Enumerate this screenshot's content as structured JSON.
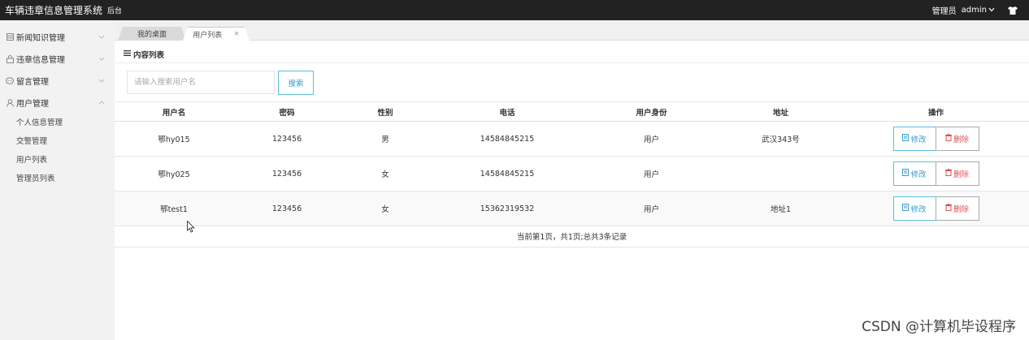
{
  "header": {
    "app_title": "车辆违章信息管理系统",
    "app_subtitle": "后台",
    "role_label": "管理员",
    "username": "admin",
    "shirt_icon": "tshirt-icon"
  },
  "sidebar": {
    "items": [
      {
        "label": "新闻知识管理",
        "icon": "grid-icon",
        "expanded": false
      },
      {
        "label": "违章信息管理",
        "icon": "lock-icon",
        "expanded": false
      },
      {
        "label": "留言管理",
        "icon": "chat-icon",
        "expanded": false
      },
      {
        "label": "用户管理",
        "icon": "user-icon",
        "expanded": true
      }
    ],
    "submenu": [
      {
        "label": "个人信息管理"
      },
      {
        "label": "交警管理"
      },
      {
        "label": "用户列表"
      },
      {
        "label": "管理员列表"
      }
    ]
  },
  "tabs": [
    {
      "label": "我的桌面",
      "active": false
    },
    {
      "label": "用户列表",
      "active": true,
      "close": "×"
    }
  ],
  "main": {
    "section_title": "内容列表",
    "search": {
      "placeholder": "请输入搜索用户名",
      "button_label": "搜索"
    },
    "table": {
      "columns": [
        "用户名",
        "密码",
        "性别",
        "电话",
        "用户身份",
        "地址",
        "操作"
      ],
      "rows": [
        {
          "username": "鄂hy015",
          "password": "123456",
          "gender": "男",
          "phone": "14584845215",
          "role": "用户",
          "address": "武汉343号"
        },
        {
          "username": "鄂hy025",
          "password": "123456",
          "gender": "女",
          "phone": "14584845215",
          "role": "用户",
          "address": ""
        },
        {
          "username": "鄂test1",
          "password": "123456",
          "gender": "女",
          "phone": "15362319532",
          "role": "用户",
          "address": "地址1"
        }
      ],
      "edit_label": "修改",
      "delete_label": "删除"
    },
    "pager_text": "当前第1页，共1页;总共3条记录"
  },
  "watermark": "CSDN @计算机毕设程序",
  "colors": {
    "topbar": "#222222",
    "accent": "#5bc0de",
    "danger": "#e05050"
  }
}
